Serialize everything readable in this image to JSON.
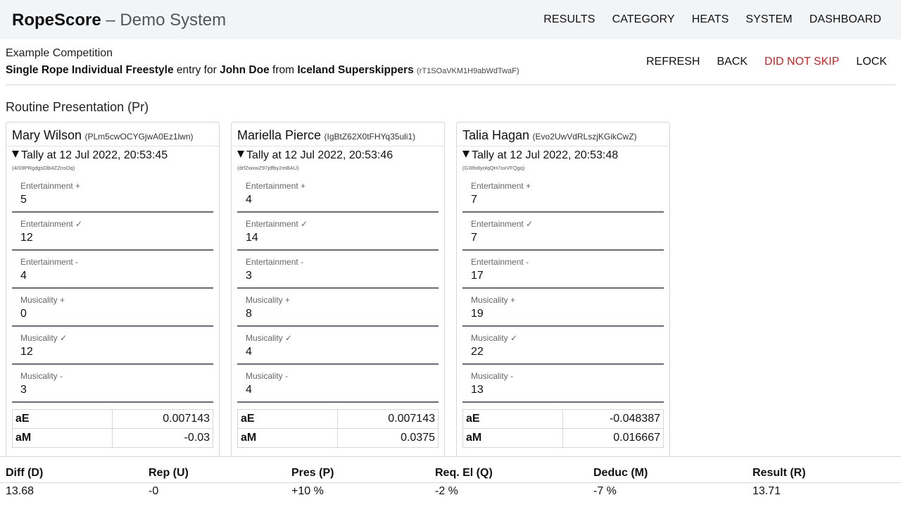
{
  "navbar": {
    "brand": "RopeScore",
    "separator": "–",
    "subtitle": "Demo System",
    "links": [
      "RESULTS",
      "CATEGORY",
      "HEATS",
      "SYSTEM",
      "DASHBOARD"
    ]
  },
  "header": {
    "competition": "Example Competition",
    "category": "Single Rope Individual Freestyle",
    "entry_for": "entry for",
    "participant": "John Doe",
    "from": "from",
    "team": "Iceland Superskippers",
    "entry_id": "(rT1SOaVKM1H9abWdTwaF)",
    "actions": [
      "REFRESH",
      "BACK",
      "DID NOT SKIP",
      "LOCK"
    ]
  },
  "section_title": "Routine Presentation (Pr)",
  "judges": [
    {
      "name": "Mary Wilson",
      "id": "(PLm5cwOCYGjwA0Ez1lwn)",
      "tally": "Tally at 12 Jul 2022, 20:53:45",
      "tally_id": "(4iS9PRgdgsDlb4ZZnsOq)",
      "fields": [
        {
          "label": "Entertainment +",
          "value": "5"
        },
        {
          "label": "Entertainment ✓",
          "value": "12"
        },
        {
          "label": "Entertainment -",
          "value": "4"
        },
        {
          "label": "Musicality +",
          "value": "0"
        },
        {
          "label": "Musicality ✓",
          "value": "12"
        },
        {
          "label": "Musicality -",
          "value": "3"
        }
      ],
      "results": [
        {
          "key": "aE",
          "value": "0.007143"
        },
        {
          "key": "aM",
          "value": "-0.03"
        }
      ]
    },
    {
      "name": "Mariella Pierce",
      "id": "(IgBtZ62X0tFHYq35uli1)",
      "tally": "Tally at 12 Jul 2022, 20:53:46",
      "tally_id": "(drfZwxwZ97jdfby2mBAU)",
      "fields": [
        {
          "label": "Entertainment +",
          "value": "4"
        },
        {
          "label": "Entertainment ✓",
          "value": "14"
        },
        {
          "label": "Entertainment -",
          "value": "3"
        },
        {
          "label": "Musicality +",
          "value": "8"
        },
        {
          "label": "Musicality ✓",
          "value": "4"
        },
        {
          "label": "Musicality -",
          "value": "4"
        }
      ],
      "results": [
        {
          "key": "aE",
          "value": "0.007143"
        },
        {
          "key": "aM",
          "value": "0.0375"
        }
      ]
    },
    {
      "name": "Talia Hagan",
      "id": "(Evo2UwVdRLszjKGikCwZ)",
      "tally": "Tally at 12 Jul 2022, 20:53:48",
      "tally_id": "(G3Ifo8yolqQH7oxVFQgq)",
      "fields": [
        {
          "label": "Entertainment +",
          "value": "7"
        },
        {
          "label": "Entertainment ✓",
          "value": "7"
        },
        {
          "label": "Entertainment -",
          "value": "17"
        },
        {
          "label": "Musicality +",
          "value": "19"
        },
        {
          "label": "Musicality ✓",
          "value": "22"
        },
        {
          "label": "Musicality -",
          "value": "13"
        }
      ],
      "results": [
        {
          "key": "aE",
          "value": "-0.048387"
        },
        {
          "key": "aM",
          "value": "0.016667"
        }
      ]
    }
  ],
  "summary": [
    {
      "label": "Diff (D)",
      "value": "13.68"
    },
    {
      "label": "Rep (U)",
      "value": "-0"
    },
    {
      "label": "Pres (P)",
      "value": "+10 %"
    },
    {
      "label": "Req. El (Q)",
      "value": "-2 %"
    },
    {
      "label": "Deduc (M)",
      "value": "-7 %"
    },
    {
      "label": "Result (R)",
      "value": "13.71"
    }
  ],
  "colors": {
    "navbar_bg": "#f3f4f6",
    "danger": "#d62020",
    "field_underline": "#6b6e7a"
  }
}
